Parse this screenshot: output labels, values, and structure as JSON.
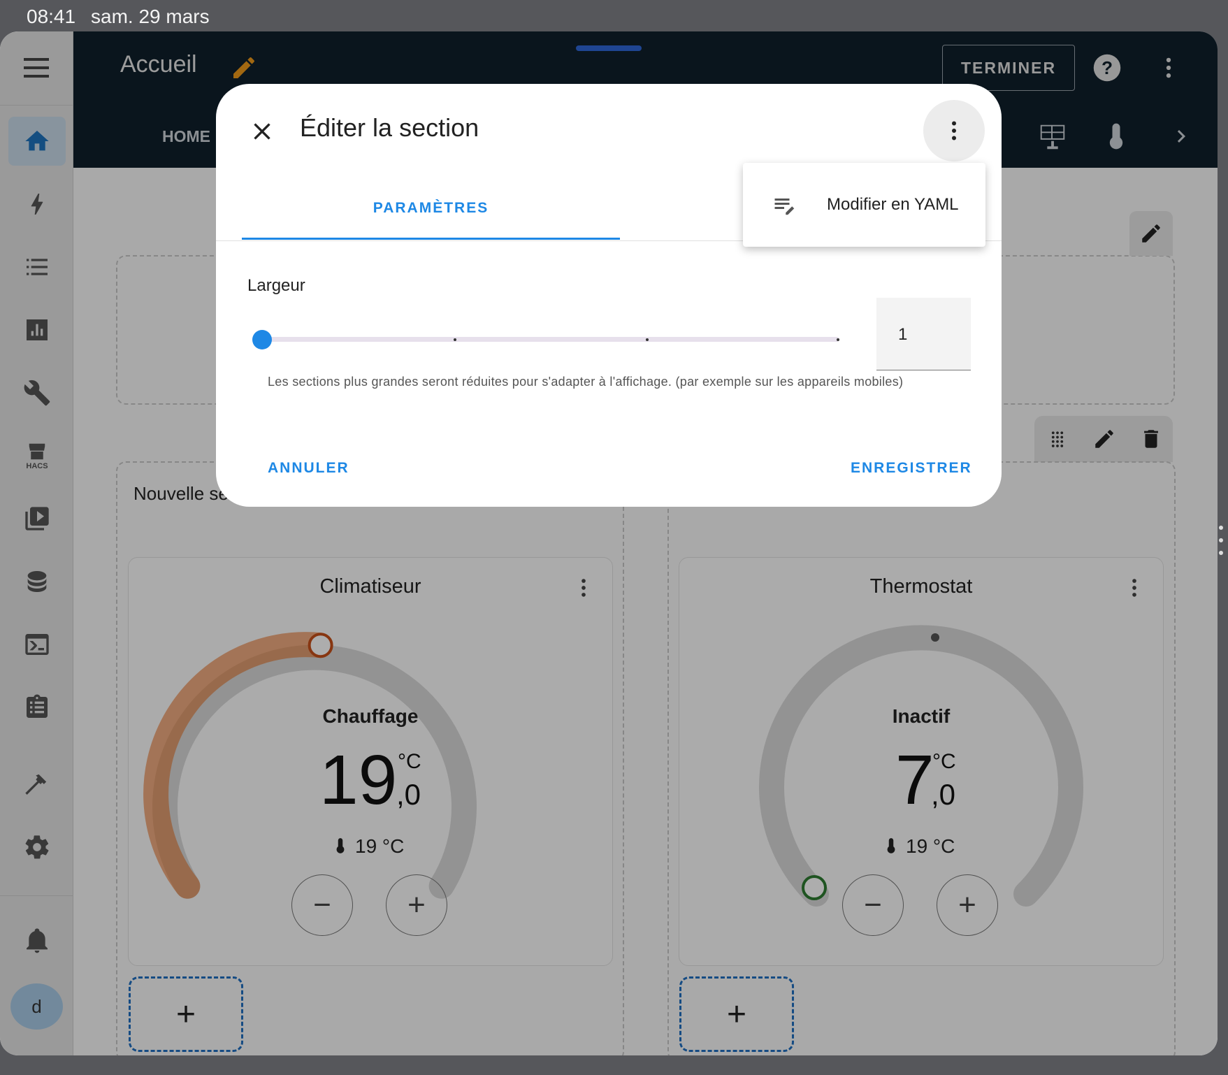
{
  "status_bar": {
    "time": "08:41",
    "date": "sam. 29 mars"
  },
  "header": {
    "title": "Accueil",
    "done_label": "TERMINER",
    "tab_home": "HOME"
  },
  "sidebar": {
    "hacs_label": "HACS",
    "avatar_letter": "d"
  },
  "sections": {
    "new_section_title": "Nouvelle section"
  },
  "cards": [
    {
      "title": "Climatiseur",
      "mode": "Chauffage",
      "target_int": "19",
      "target_dec": ",0",
      "unit": "°C",
      "current": "19 °C",
      "arc_color": "#e86a19",
      "target_fraction": 0.36
    },
    {
      "title": "Thermostat",
      "mode": "Inactif",
      "target_int": "7",
      "target_dec": ",0",
      "unit": "°C",
      "current": "19 °C",
      "arc_color": "#2e7d32",
      "target_fraction": 0.0
    }
  ],
  "dialog": {
    "title": "Éditer la section",
    "tab_settings": "PARAMÈTRES",
    "width_label": "Largeur",
    "width_value": "1",
    "width_slider_value": 1,
    "width_slider_max": 4,
    "helper_text": "Les sections plus grandes seront réduites pour s'adapter à l'affichage. (par exemple sur les appareils mobiles)",
    "cancel_label": "ANNULER",
    "save_label": "ENREGISTRER",
    "accent_color": "#1e88e5"
  },
  "overflow_menu": {
    "edit_yaml_label": "Modifier en YAML"
  }
}
